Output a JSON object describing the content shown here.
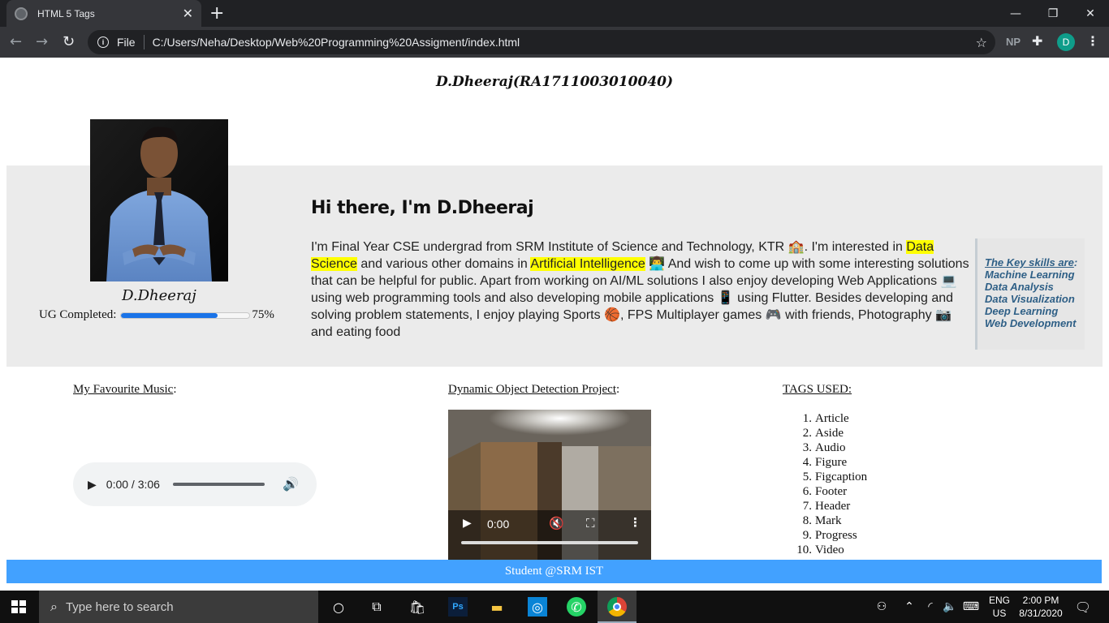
{
  "browser": {
    "tab_title": "HTML 5 Tags",
    "new_tab_symbol": "+",
    "address_prefix": "File",
    "url": "C:/Users/Neha/Desktop/Web%20Programming%20Assigment/index.html",
    "extension_np": "NP",
    "profile_initial": "D"
  },
  "page": {
    "header": "D.Dheeraj(RA1711003010040)",
    "figure_caption": "D.Dheeraj",
    "progress": {
      "label": "UG Completed:",
      "value_text": "75%",
      "value": 0.75
    },
    "article": {
      "title": "Hi there, I'm D.Dheeraj",
      "bio_1": "I'm Final Year CSE undergrad from SRM Institute of Science and Technology, KTR 🏫. I'm interested in ",
      "mark_1": "Data Science",
      "bio_2": " and various other domains in ",
      "mark_2": "Artificial Intelligence",
      "bio_3": " 👨‍💻 And wish to come up with some interesting solutions that can be helpful for public. Apart from working on AI/ML solutions I also enjoy developing Web Applications 💻 using web programming tools and also developing mobile applications 📱 using Flutter. Besides developing and solving problem statements, I enjoy playing Sports 🏀, FPS Multiplayer games 🎮 with friends, Photography 📷 and eating food"
    },
    "aside": {
      "heading": "The Key skills are",
      "skills": [
        "Machine Learning",
        "Data Analysis",
        "Data Visualization",
        "Deep Learning",
        "Web Development"
      ]
    },
    "music": {
      "label": "My Favourite Music",
      "time": "0:00 / 3:06"
    },
    "video": {
      "label": "Dynamic Object Detection Project",
      "time": "0:00"
    },
    "tags": {
      "label": "TAGS USED:",
      "items": [
        "Article",
        "Aside",
        "Audio",
        "Figure",
        "Figcaption",
        "Footer",
        "Header",
        "Mark",
        "Progress",
        "Video"
      ]
    },
    "footer": "Student @SRM IST"
  },
  "taskbar": {
    "search_placeholder": "Type here to search",
    "lang_top": "ENG",
    "lang_bottom": "US",
    "time": "2:00 PM",
    "date": "8/31/2020"
  }
}
